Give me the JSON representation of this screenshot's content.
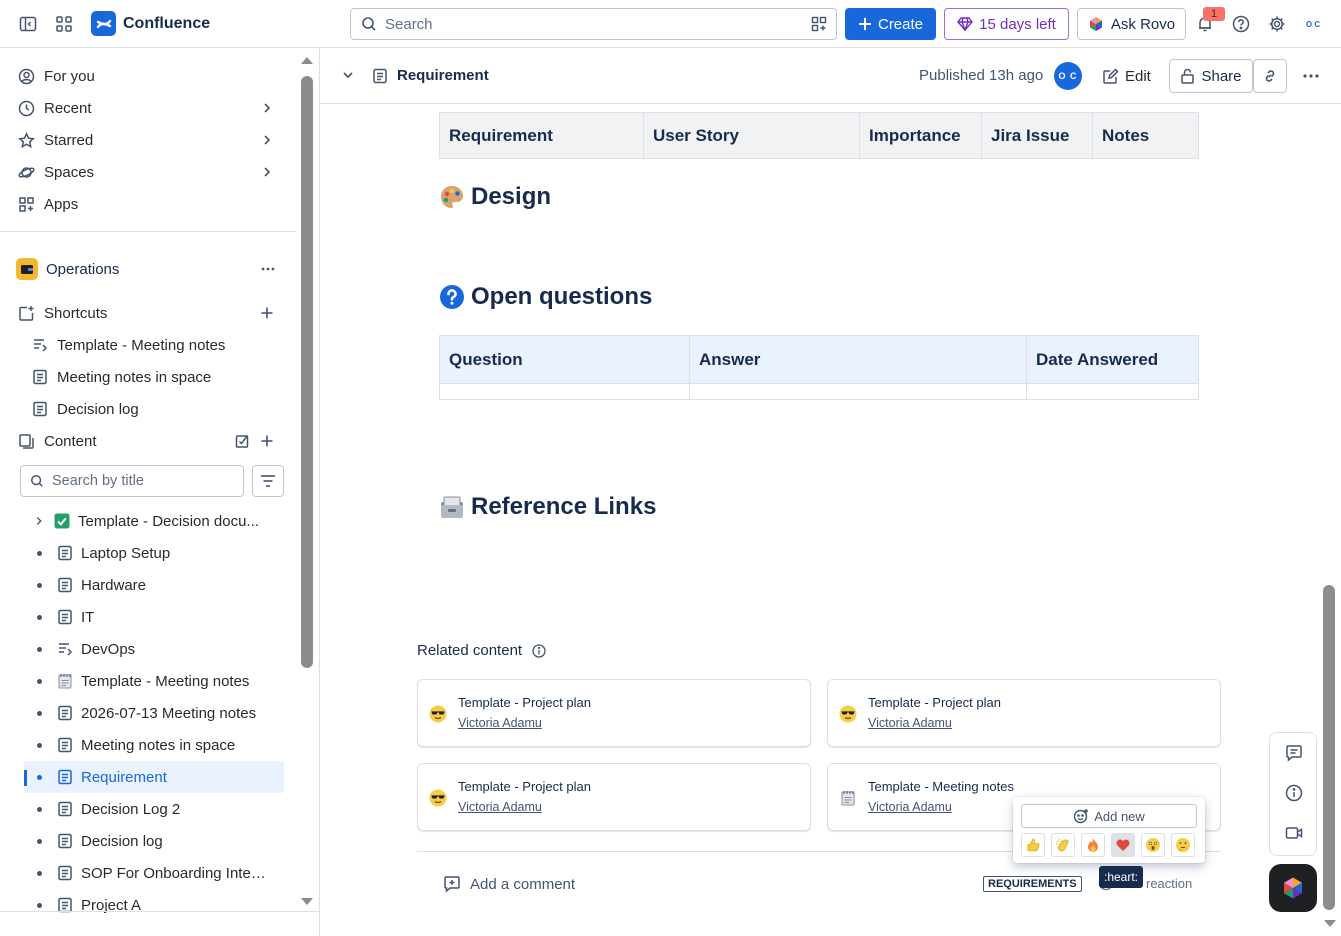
{
  "topbar": {
    "app_name": "Confluence",
    "search_placeholder": "Search",
    "create_label": "Create",
    "trial_label": "15 days left",
    "rovo_label": "Ask Rovo",
    "notification_count": "1",
    "profile_initials": "O C"
  },
  "sidebar": {
    "nav": [
      {
        "label": "For you"
      },
      {
        "label": "Recent"
      },
      {
        "label": "Starred"
      },
      {
        "label": "Spaces"
      },
      {
        "label": "Apps"
      }
    ],
    "space_name": "Operations",
    "shortcuts_label": "Shortcuts",
    "shortcuts": [
      {
        "label": "Template - Meeting notes"
      },
      {
        "label": "Meeting notes in space"
      },
      {
        "label": "Decision log"
      }
    ],
    "content_label": "Content",
    "search_placeholder": "Search by title",
    "tree": [
      {
        "label": "Template - Decision docu...",
        "icon": "check-emoji"
      },
      {
        "label": "Laptop Setup",
        "icon": "page"
      },
      {
        "label": "Hardware",
        "icon": "page"
      },
      {
        "label": "IT",
        "icon": "page"
      },
      {
        "label": "DevOps",
        "icon": "template"
      },
      {
        "label": "Template - Meeting notes",
        "icon": "notepad-emoji"
      },
      {
        "label": "2026-07-13 Meeting notes",
        "icon": "page"
      },
      {
        "label": "Meeting notes in space",
        "icon": "page"
      },
      {
        "label": "Requirement",
        "icon": "page",
        "active": true
      },
      {
        "label": "Decision Log 2",
        "icon": "page"
      },
      {
        "label": "Decision log",
        "icon": "page"
      },
      {
        "label": "SOP For Onboarding Inter...",
        "icon": "page"
      },
      {
        "label": "Project A",
        "icon": "page"
      }
    ]
  },
  "page_header": {
    "title": "Requirement",
    "published": "Published 13h ago",
    "avatar_initials": "O C",
    "edit_label": "Edit",
    "share_label": "Share"
  },
  "content": {
    "requirements_table": {
      "headers": [
        "Requirement",
        "User Story",
        "Importance",
        "Jira Issue",
        "Notes"
      ]
    },
    "design_heading": "Design",
    "questions_heading": "Open questions",
    "questions_table": {
      "headers": [
        "Question",
        "Answer",
        "Date Answered"
      ]
    },
    "reference_heading": "Reference Links",
    "related_title": "Related content",
    "related_cards": [
      {
        "title": "Template - Project plan",
        "author": "Victoria Adamu",
        "icon": "sunglasses-emoji"
      },
      {
        "title": "Template - Project plan",
        "author": "Victoria Adamu",
        "icon": "sunglasses-emoji"
      },
      {
        "title": "Template - Project plan",
        "author": "Victoria Adamu",
        "icon": "sunglasses-emoji"
      },
      {
        "title": "Template - Meeting notes",
        "author": "Victoria Adamu",
        "icon": "notepad-emoji"
      }
    ],
    "comment_label": "Add a comment",
    "label_tag": "REQUIREMENTS",
    "reaction_label": "reaction"
  },
  "reaction_popup": {
    "add_new_label": "Add new",
    "emojis": [
      "thumbs-up",
      "clap",
      "fire",
      "heart",
      "astonished",
      "thinking"
    ],
    "tooltip": ":heart:"
  },
  "colors": {
    "brand": "#1868db",
    "trial": "#6e2fbf",
    "notification": "#f87168"
  }
}
